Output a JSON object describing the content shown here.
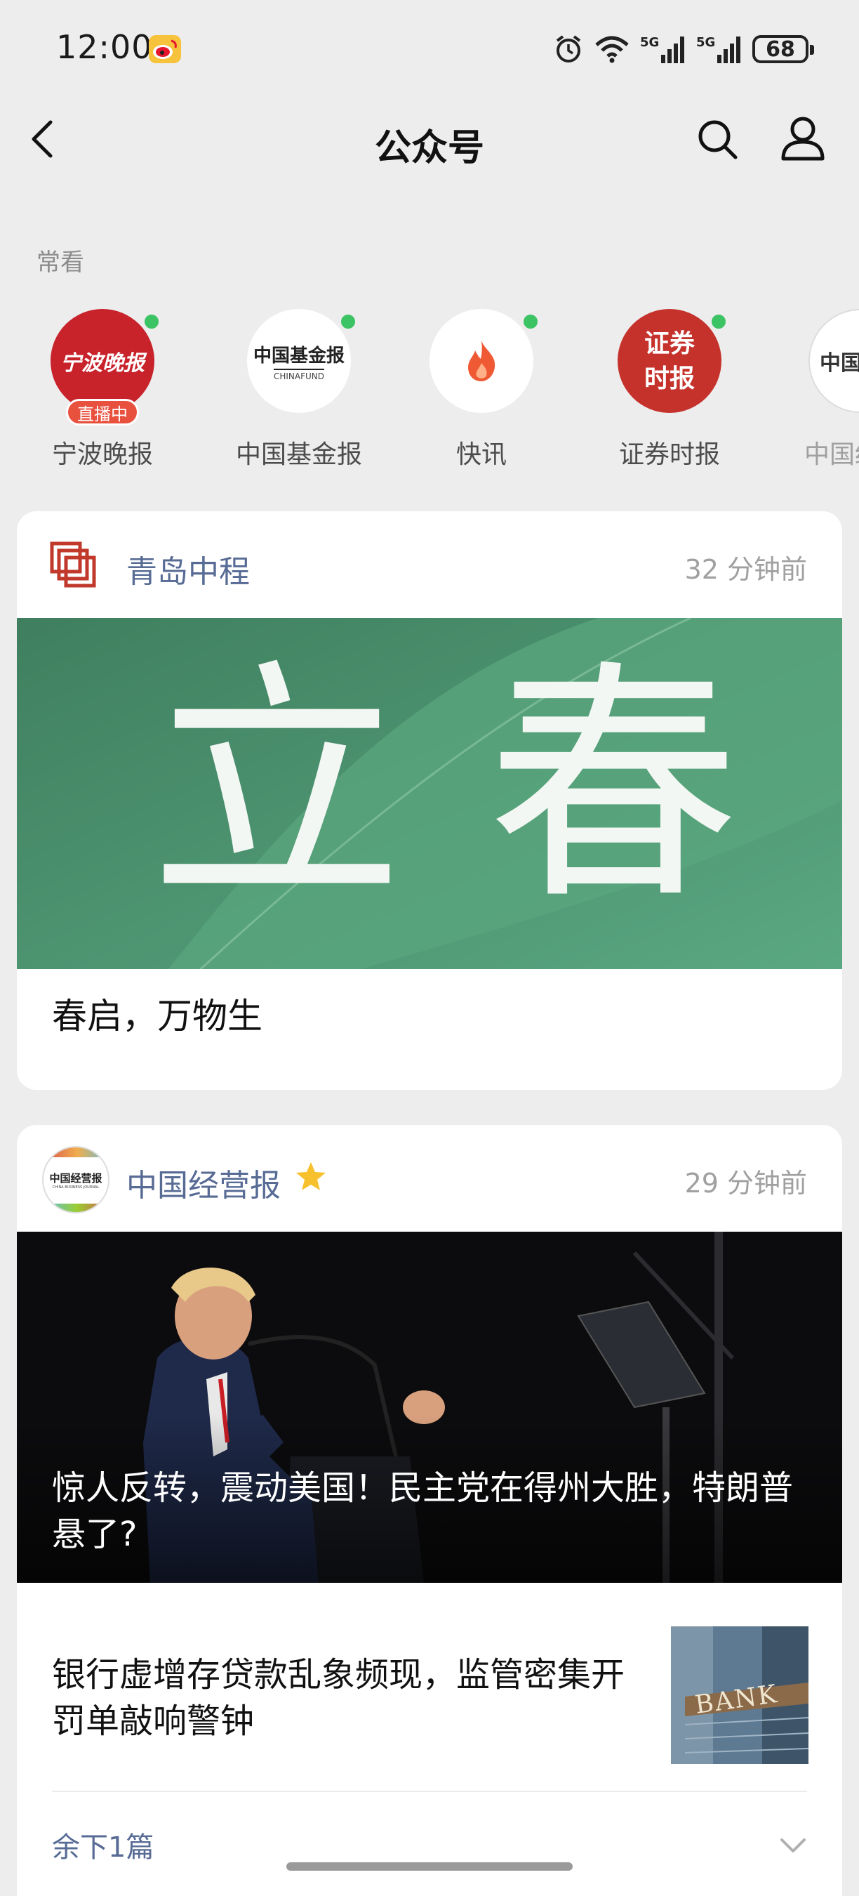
{
  "status_bar": {
    "time": "12:00",
    "network": "5G",
    "battery": "68"
  },
  "nav": {
    "title": "公众号"
  },
  "frequent": {
    "section_label": "常看",
    "items": [
      {
        "name": "宁波晚报",
        "logo_text": "宁波晚报",
        "badge": "直播中",
        "has_update": true
      },
      {
        "name": "中国基金报",
        "logo_text": "中国基金报",
        "logo_subtext": "CHINAFUND",
        "has_update": true
      },
      {
        "name": "快讯",
        "has_update": true
      },
      {
        "name": "证券时报",
        "logo_text": "证券时报",
        "has_update": true
      },
      {
        "name": "中国经",
        "logo_text": "中国经",
        "has_update": false
      }
    ]
  },
  "cards": [
    {
      "account": "青岛中程",
      "time": "32 分钟前",
      "cover_text": "立春",
      "article_title": "春启，万物生",
      "colors": {
        "cover": "#4e9a76"
      }
    },
    {
      "account": "中国经营报",
      "starred": true,
      "time": "29 分钟前",
      "logo_text": "中国经营报",
      "logo_subtext": "CHINA BUSINESS JOURNAL",
      "cover_title": "惊人反转，震动美国！民主党在得州大胜，特朗普悬了?",
      "sub_article": {
        "title": "银行虚增存贷款乱象频现，监管密集开罚单敲响警钟",
        "thumb_text": "BANK"
      },
      "remaining": "余下1篇"
    }
  ],
  "colors": {
    "link_blue": "#576b95",
    "update_dot": "#3cc364",
    "live_badge": "#e9513f"
  }
}
